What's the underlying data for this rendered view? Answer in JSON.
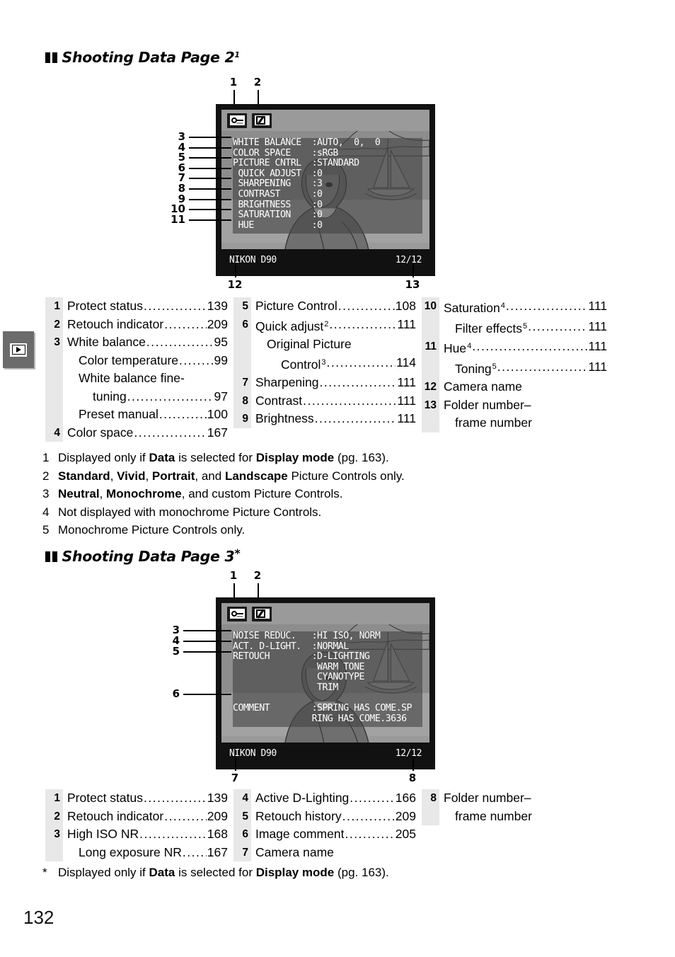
{
  "page": {
    "number": "132",
    "margin_tab_icon": "playback-icon"
  },
  "sections": [
    {
      "heading": "Shooting Data Page 2",
      "heading_sup": "1",
      "lcd": {
        "icons": [
          "protect-key-icon",
          "retouch-icon"
        ],
        "icon_callouts": [
          "1",
          "2"
        ],
        "rows": [
          {
            "label": "WHITE BALANCE",
            "value": ":AUTO,  0,  0"
          },
          {
            "label": "COLOR SPACE",
            "value": ":sRGB"
          },
          {
            "label": "PICTURE CNTRL",
            "value": ":STANDARD"
          },
          {
            "label": " QUICK ADJUST",
            "value": ":0"
          },
          {
            "label": " SHARPENING",
            "value": ":3"
          },
          {
            "label": " CONTRAST",
            "value": ":0"
          },
          {
            "label": " BRIGHTNESS",
            "value": ":0"
          },
          {
            "label": " SATURATION",
            "value": ":0"
          },
          {
            "label": " HUE",
            "value": ":0"
          }
        ],
        "left_callouts": [
          "3",
          "4",
          "5",
          "6",
          "7",
          "8",
          "9",
          "10",
          "11"
        ],
        "footer_left": "NIKON D90",
        "footer_right": "12/12",
        "footer_callout_left": "12",
        "footer_callout_right": "13"
      },
      "index": {
        "col1": [
          {
            "num": "1",
            "label": "Protect status",
            "page": "139"
          },
          {
            "num": "2",
            "label": "Retouch indicator",
            "page": "209"
          },
          {
            "num": "3",
            "label": "White balance",
            "page": "95"
          },
          {
            "num": "",
            "label": "Color temperature",
            "page": "99",
            "indent": 1
          },
          {
            "num": "",
            "label": "White balance fine-",
            "page": "",
            "indent": 1,
            "nodots": true
          },
          {
            "num": "",
            "label": "tuning",
            "page": "97",
            "indent": 2
          },
          {
            "num": "",
            "label": "Preset manual",
            "page": "100",
            "indent": 1
          },
          {
            "num": "4",
            "label": "Color space",
            "page": "167"
          }
        ],
        "col2": [
          {
            "num": "5",
            "label": "Picture Control",
            "page": "108"
          },
          {
            "num": "6",
            "label": "Quick adjust",
            "sup": "2",
            "page": "111"
          },
          {
            "num": "",
            "label": "Original Picture",
            "page": "",
            "indent": 1,
            "nodots": true
          },
          {
            "num": "",
            "label": "Control",
            "sup": "3",
            "page": "114",
            "indent": 2
          },
          {
            "num": "7",
            "label": "Sharpening",
            "page": "111"
          },
          {
            "num": "8",
            "label": "Contrast",
            "page": "111"
          },
          {
            "num": "9",
            "label": "Brightness",
            "page": "111"
          }
        ],
        "col3": [
          {
            "num": "10",
            "label": "Saturation",
            "sup": "4",
            "page": "111"
          },
          {
            "num": "",
            "label": "Filter effects",
            "sup": "5",
            "page": "111",
            "indent": 1
          },
          {
            "num": "11",
            "label": "Hue",
            "sup": "4",
            "page": "111"
          },
          {
            "num": "",
            "label": "Toning",
            "sup": "5",
            "page": "111",
            "indent": 1
          },
          {
            "num": "12",
            "label": "Camera name",
            "page": "",
            "nodots": true
          },
          {
            "num": "13",
            "label": "Folder number–",
            "page": "",
            "nodots": true
          },
          {
            "num": "",
            "label": "frame number",
            "page": "",
            "indent": 1,
            "nodots": true
          }
        ]
      },
      "footnotes": [
        {
          "marker": "1",
          "parts": [
            {
              "t": "Displayed only if ",
              "b": false
            },
            {
              "t": "Data",
              "b": true
            },
            {
              "t": " is selected for ",
              "b": false
            },
            {
              "t": "Display mode",
              "b": true
            },
            {
              "t": " (pg. 163).",
              "b": false
            }
          ]
        },
        {
          "marker": "2",
          "parts": [
            {
              "t": "Standard",
              "b": true
            },
            {
              "t": ", ",
              "b": false
            },
            {
              "t": "Vivid",
              "b": true
            },
            {
              "t": ", ",
              "b": false
            },
            {
              "t": "Portrait",
              "b": true
            },
            {
              "t": ", and ",
              "b": false
            },
            {
              "t": "Landscape",
              "b": true
            },
            {
              "t": " Picture Controls only.",
              "b": false
            }
          ]
        },
        {
          "marker": "3",
          "parts": [
            {
              "t": "Neutral",
              "b": true
            },
            {
              "t": ", ",
              "b": false
            },
            {
              "t": "Monochrome",
              "b": true
            },
            {
              "t": ", and custom Picture Controls.",
              "b": false
            }
          ]
        },
        {
          "marker": "4",
          "parts": [
            {
              "t": "Not displayed with monochrome Picture Controls.",
              "b": false
            }
          ]
        },
        {
          "marker": "5",
          "parts": [
            {
              "t": "Monochrome Picture Controls only.",
              "b": false
            }
          ]
        }
      ]
    },
    {
      "heading": "Shooting Data Page 3",
      "heading_sup": "*",
      "lcd": {
        "icons": [
          "protect-key-icon",
          "retouch-icon"
        ],
        "icon_callouts": [
          "1",
          "2"
        ],
        "rows": [
          {
            "label": "NOISE REDUC.",
            "value": ":HI ISO, NORM"
          },
          {
            "label": "ACT. D-LIGHT.",
            "value": ":NORMAL"
          },
          {
            "label": "RETOUCH",
            "value": ":D-LIGHTING"
          },
          {
            "label": "",
            "value": " WARM TONE"
          },
          {
            "label": "",
            "value": " CYANOTYPE"
          },
          {
            "label": "",
            "value": " TRIM"
          },
          {
            "label": "",
            "value": ""
          },
          {
            "label": "COMMENT",
            "value": ":SPRING HAS COME.SP"
          },
          {
            "label": "",
            "value": "RING HAS COME.3636"
          }
        ],
        "left_callouts": [
          "3",
          "4",
          "5",
          "6"
        ],
        "footer_left": "NIKON D90",
        "footer_right": "12/12",
        "footer_callout_left": "7",
        "footer_callout_right": "8"
      },
      "index": {
        "col1": [
          {
            "num": "1",
            "label": "Protect status",
            "page": "139"
          },
          {
            "num": "2",
            "label": "Retouch indicator",
            "page": "209"
          },
          {
            "num": "3",
            "label": "High ISO NR",
            "page": "168"
          },
          {
            "num": "",
            "label": "Long exposure NR",
            "page": "167",
            "indent": 1
          }
        ],
        "col2": [
          {
            "num": "4",
            "label": "Active D-Lighting",
            "page": "166"
          },
          {
            "num": "5",
            "label": "Retouch history",
            "page": "209"
          },
          {
            "num": "6",
            "label": "Image comment",
            "page": "205"
          },
          {
            "num": "7",
            "label": "Camera name",
            "page": "",
            "nodots": true
          }
        ],
        "col3": [
          {
            "num": "8",
            "label": "Folder number–",
            "page": "",
            "nodots": true
          },
          {
            "num": "",
            "label": "frame number",
            "page": "",
            "indent": 1,
            "nodots": true
          }
        ]
      },
      "footnotes": [
        {
          "marker": "*",
          "parts": [
            {
              "t": "Displayed only if ",
              "b": false
            },
            {
              "t": "Data",
              "b": true
            },
            {
              "t": " is selected for ",
              "b": false
            },
            {
              "t": "Display mode",
              "b": true
            },
            {
              "t": " (pg. 163).",
              "b": false
            }
          ]
        }
      ]
    }
  ]
}
